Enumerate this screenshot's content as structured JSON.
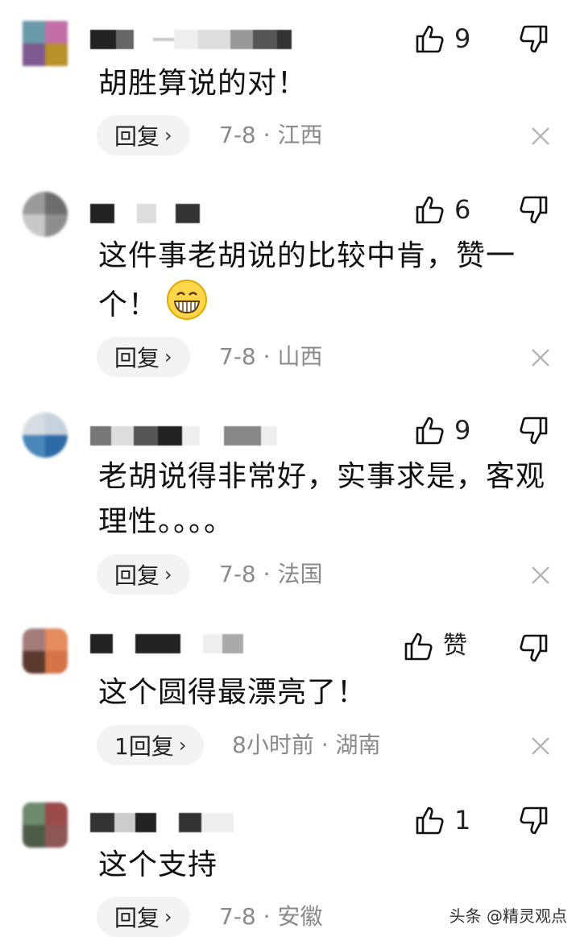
{
  "comments": [
    {
      "text": "胡胜算说的对！",
      "likes": "9",
      "reply_label": "回复",
      "date": "7-8",
      "separator": "·",
      "location": "江西",
      "avatar_colors": [
        "#6b9aa8",
        "#c26fa6",
        "#7d5a8f",
        "#b8902c"
      ]
    },
    {
      "text": "这件事老胡说的比较中肯，赞一个！",
      "likes": "6",
      "reply_label": "回复",
      "date": "7-8",
      "separator": "·",
      "location": "山西",
      "avatar_colors": [
        "#9a9a9a",
        "#6d6d6d",
        "#c8c8c8",
        "#8e8e8e"
      ]
    },
    {
      "text": "老胡说得非常好，实事求是，客观理性。。。。",
      "likes": "9",
      "reply_label": "回复",
      "date": "7-8",
      "separator": "·",
      "location": "法国",
      "avatar_colors": [
        "#d5dde3",
        "#4a86b8",
        "#c6d2dc",
        "#2d6aa6"
      ]
    },
    {
      "text": "这个圆得最漂亮了！",
      "likes": "赞",
      "reply_label": "1回复",
      "date": "8小时前",
      "separator": "·",
      "location": "湖南",
      "avatar_colors": [
        "#a37c7c",
        "#e58b5e",
        "#5a3a2e",
        "#d4744a"
      ]
    },
    {
      "text": "这个支持",
      "likes": "1",
      "reply_label": "回复",
      "date": "7-8",
      "separator": "·",
      "location": "安徽",
      "avatar_colors": [
        "#6f8a6d",
        "#9a4a4a",
        "#4f5b4a",
        "#8e5757"
      ]
    }
  ],
  "watermark": "头条 @精灵观点"
}
